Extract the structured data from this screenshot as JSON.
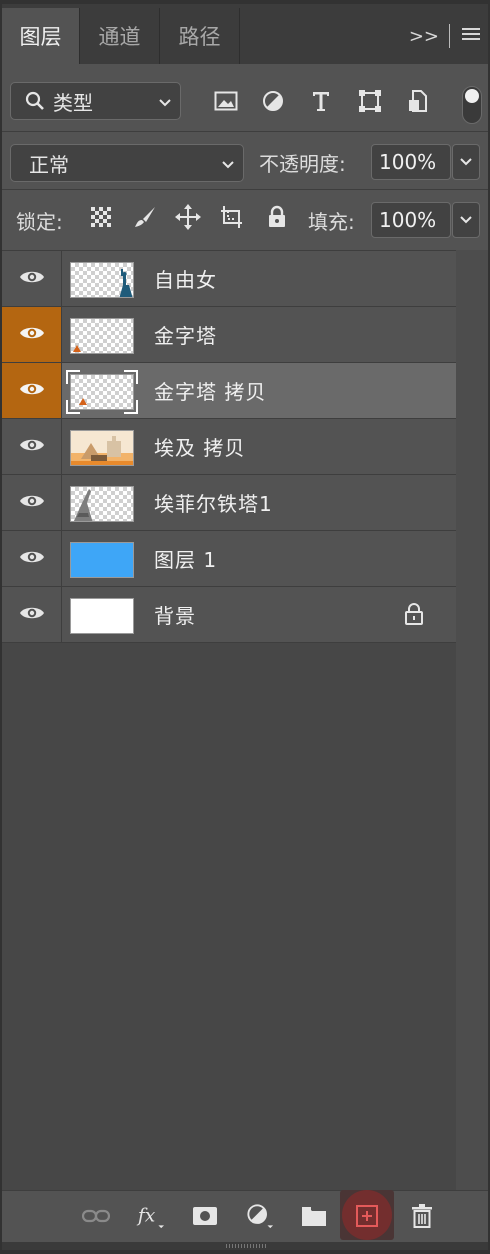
{
  "tabs": [
    {
      "label": "图层",
      "active": true
    },
    {
      "label": "通道",
      "active": false
    },
    {
      "label": "路径",
      "active": false
    }
  ],
  "tab_controls": {
    "collapse_label": ">>"
  },
  "filter": {
    "kind_label": "类型",
    "icons": [
      "image-filter-icon",
      "adjustment-filter-icon",
      "type-filter-icon",
      "shape-filter-icon",
      "smart-object-filter-icon"
    ],
    "toggle_on": true
  },
  "blend": {
    "mode": "正常",
    "opacity_label": "不透明度:",
    "opacity_value": "100%"
  },
  "lock": {
    "label": "锁定:",
    "icons": [
      "lock-transparent-icon",
      "lock-image-icon",
      "lock-position-icon",
      "lock-artboard-icon",
      "lock-all-icon"
    ],
    "fill_label": "填充:",
    "fill_value": "100%"
  },
  "layers": [
    {
      "name": "自由女",
      "visible": true,
      "highlight": false,
      "selected": false,
      "thumb": "statue-of-liberty",
      "locked": false
    },
    {
      "name": "金字塔",
      "visible": true,
      "highlight": true,
      "selected": false,
      "thumb": "pyramid",
      "locked": false
    },
    {
      "name": "金字塔 拷贝",
      "visible": true,
      "highlight": true,
      "selected": true,
      "thumb": "pyramid",
      "locked": false
    },
    {
      "name": "埃及 拷贝",
      "visible": true,
      "highlight": false,
      "selected": false,
      "thumb": "egypt-scene",
      "locked": false
    },
    {
      "name": "埃菲尔铁塔1",
      "visible": true,
      "highlight": false,
      "selected": false,
      "thumb": "eiffel-tower",
      "locked": false
    },
    {
      "name": "图层 1",
      "visible": true,
      "highlight": false,
      "selected": false,
      "thumb": "solid-blue",
      "locked": false
    },
    {
      "name": "背景",
      "visible": true,
      "highlight": false,
      "selected": false,
      "thumb": "solid-white",
      "locked": true
    }
  ],
  "bottom_icons": [
    "link-layers-icon",
    "fx-icon",
    "add-mask-icon",
    "new-adjustment-icon",
    "new-group-icon",
    "new-layer-icon",
    "delete-layer-icon"
  ],
  "colors": {
    "accent_orange": "#b46611",
    "blue_layer": "#3ea6f7",
    "panel": "#535353"
  }
}
